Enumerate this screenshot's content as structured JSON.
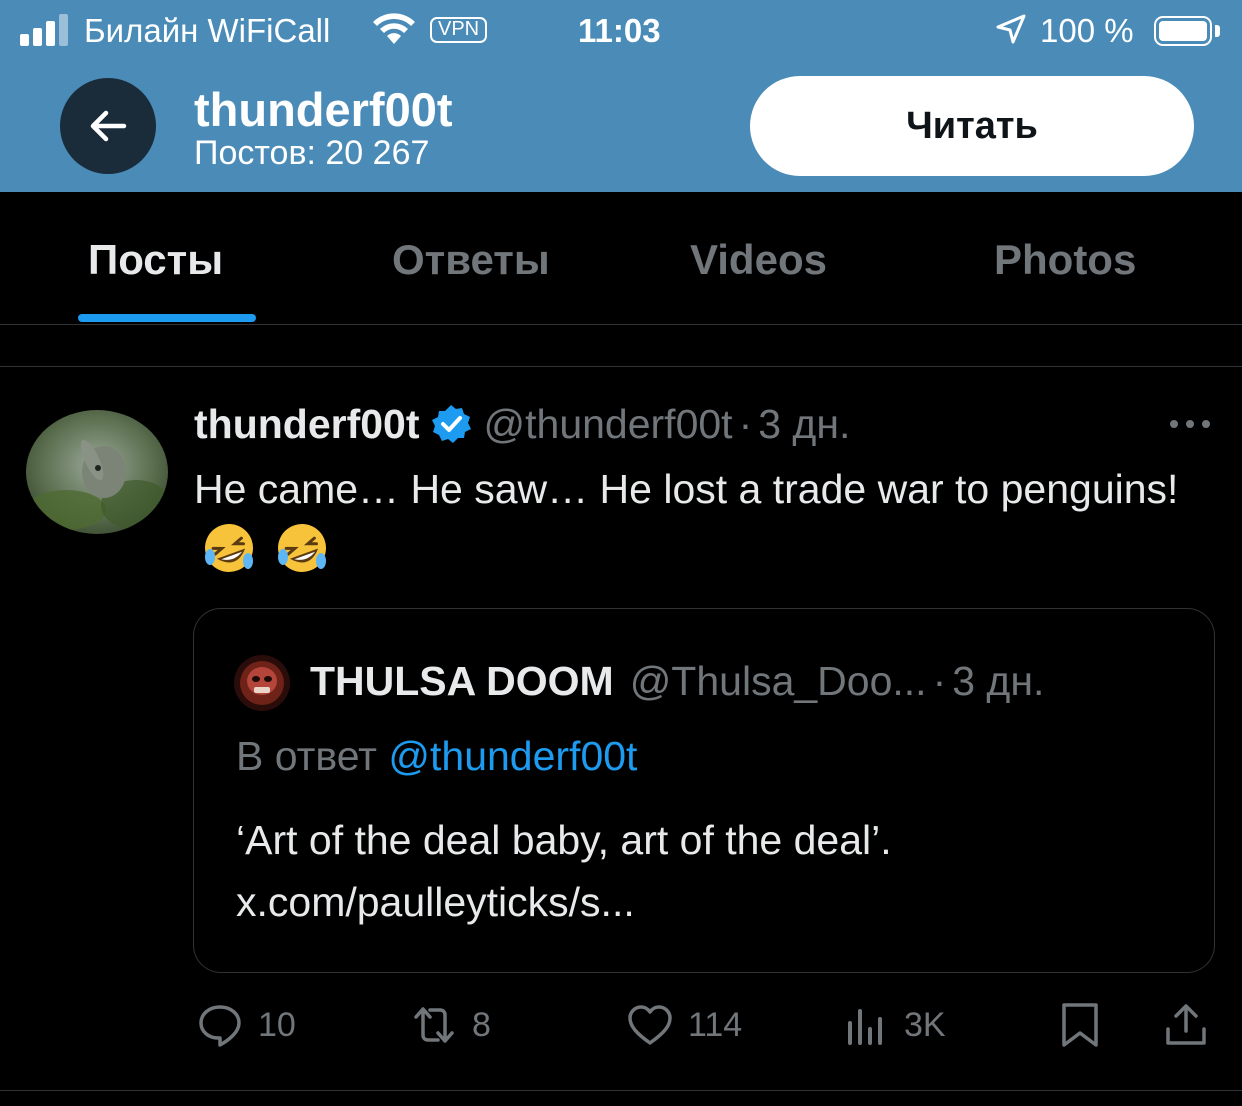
{
  "status_bar": {
    "carrier": "Билайн WiFiCall",
    "vpn": "VPN",
    "time": "11:03",
    "battery_percent": "100 %",
    "signal_bars": 3,
    "battery_level": 1.0
  },
  "profile": {
    "name": "thunderf00t",
    "posts_count": "Постов: 20 267",
    "follow_label": "Читать",
    "header_color": "#4a8bb8"
  },
  "tabs": [
    {
      "label": "Посты",
      "active": true
    },
    {
      "label": "Ответы",
      "active": false
    },
    {
      "label": "Videos",
      "active": false
    },
    {
      "label": "Photos",
      "active": false
    }
  ],
  "tweet": {
    "author_name": "thunderf00t",
    "handle": "@thunderf00t",
    "separator": "·",
    "time": "3 дн.",
    "text": "He came… He saw… He lost a trade war to penguins!",
    "emoji_icons": [
      "rofl-emoji",
      "rofl-emoji"
    ],
    "quote": {
      "author_name": "THULSA DOOM",
      "handle": "@Thulsa_Doo...",
      "separator": "·",
      "time": "3 дн.",
      "reply_prefix": "В ответ",
      "reply_to": "@thunderf00t",
      "line1": "‘Art of the deal baby, art of the deal’.",
      "line2": "x.com/paulleyticks/s..."
    },
    "actions": {
      "replies": "10",
      "reposts": "8",
      "likes": "114",
      "views": "3K"
    }
  },
  "colors": {
    "accent": "#1d9bf0",
    "muted": "#71767b",
    "text": "#e7e9ea",
    "divider": "#2f3336"
  }
}
